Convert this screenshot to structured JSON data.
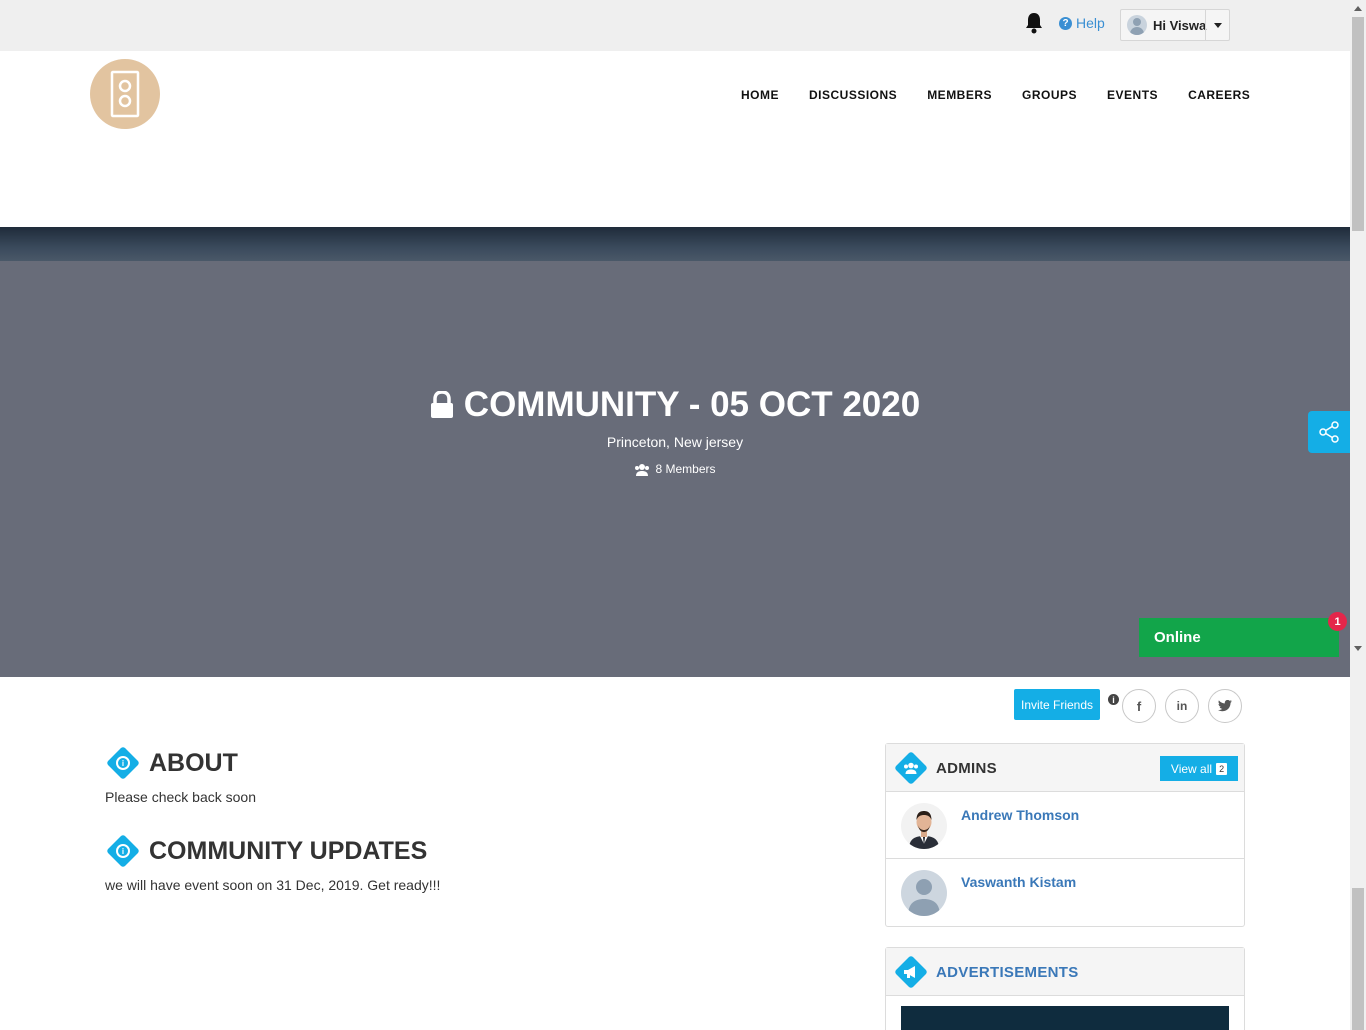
{
  "topbar": {
    "help_label": "Help",
    "greeting": "Hi Viswa"
  },
  "nav": {
    "items": [
      "HOME",
      "DISCUSSIONS",
      "MEMBERS",
      "GROUPS",
      "EVENTS",
      "CAREERS"
    ]
  },
  "hero": {
    "title": "COMMUNITY - 05 OCT 2020",
    "location": "Princeton, New jersey",
    "members": "8 Members"
  },
  "chat": {
    "status": "Online",
    "badge": "1"
  },
  "actions": {
    "invite_label": "Invite Friends",
    "social": [
      "facebook",
      "linkedin",
      "twitter"
    ]
  },
  "about": {
    "title": "ABOUT",
    "text": "Please check back soon"
  },
  "updates": {
    "title": "COMMUNITY UPDATES",
    "text": "we will have event soon on 31 Dec, 2019. Get ready!!!"
  },
  "admins": {
    "title": "ADMINS",
    "view_all_label": "View all",
    "count": "2",
    "people": [
      {
        "name": "Andrew Thomson"
      },
      {
        "name": "Vaswanth Kistam"
      }
    ]
  },
  "ads": {
    "title": "ADVERTISEMENTS"
  },
  "colors": {
    "accent": "#14aee6",
    "online": "#12a54a",
    "hero_bg": "#686c79",
    "badge": "#e4264a"
  }
}
